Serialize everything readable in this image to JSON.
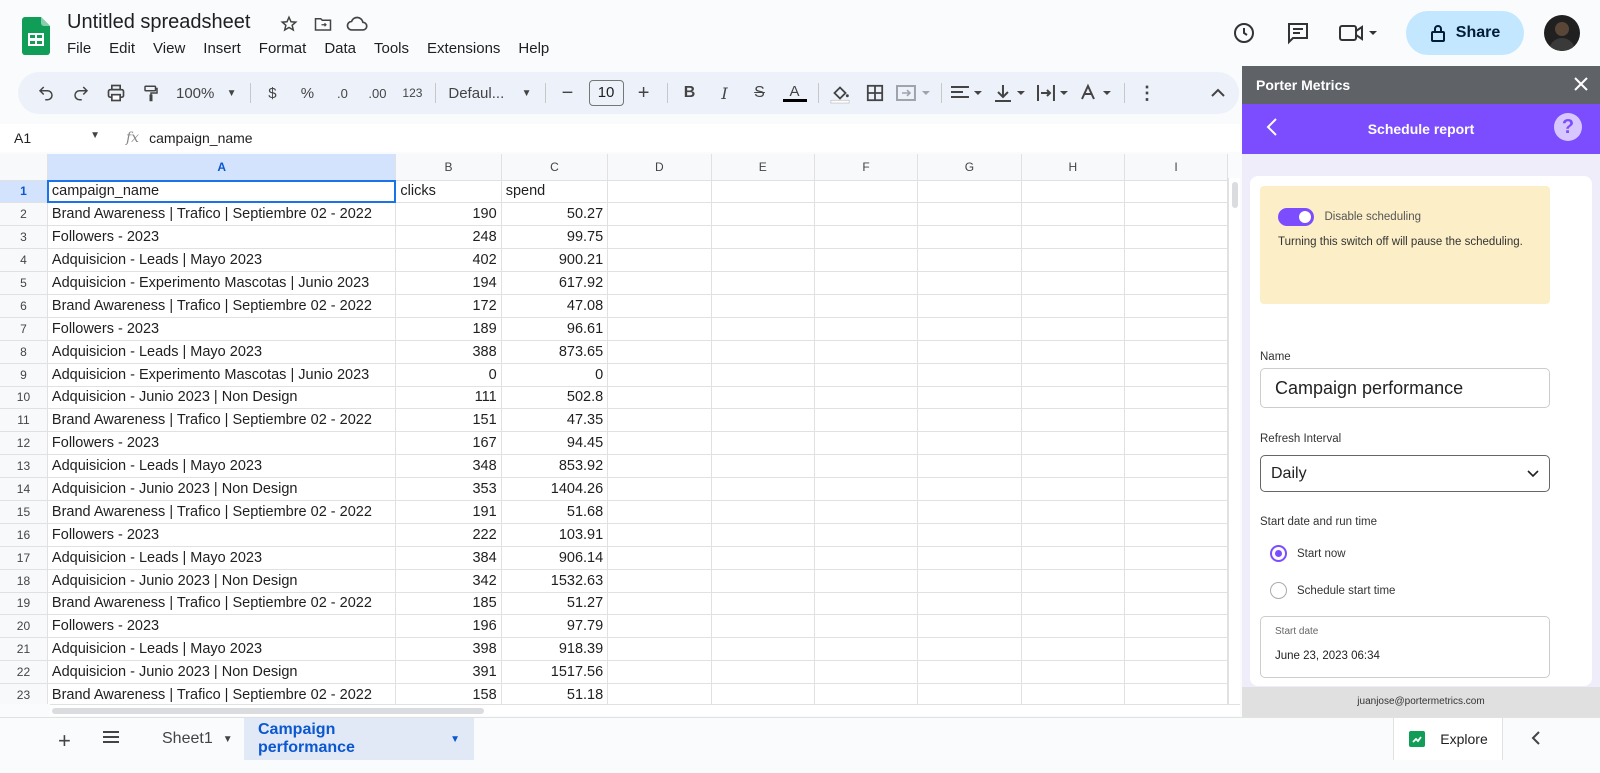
{
  "app": {
    "title": "Untitled spreadsheet"
  },
  "menu": [
    "File",
    "Edit",
    "View",
    "Insert",
    "Format",
    "Data",
    "Tools",
    "Extensions",
    "Help"
  ],
  "share_label": "Share",
  "toolbar": {
    "zoom": "100%",
    "currency": "$",
    "percent": "%",
    "dec_dec": ".0",
    "inc_dec": ".00",
    "format_num": "123",
    "font": "Defaul...",
    "font_size": "10"
  },
  "formula": {
    "cell": "A1",
    "content": "campaign_name"
  },
  "columns": [
    "A",
    "B",
    "C",
    "D",
    "E",
    "F",
    "G",
    "H",
    "I"
  ],
  "rows": [
    [
      "campaign_name",
      "clicks",
      "spend"
    ],
    [
      "Brand Awareness | Trafico | Septiembre 02 - 2022",
      "190",
      "50.27"
    ],
    [
      "Followers - 2023",
      "248",
      "99.75"
    ],
    [
      "Adquisicion - Leads | Mayo 2023",
      "402",
      "900.21"
    ],
    [
      "Adquisicion - Experimento Mascotas | Junio 2023",
      "194",
      "617.92"
    ],
    [
      "Brand Awareness | Trafico | Septiembre 02 - 2022",
      "172",
      "47.08"
    ],
    [
      "Followers - 2023",
      "189",
      "96.61"
    ],
    [
      "Adquisicion - Leads | Mayo 2023",
      "388",
      "873.65"
    ],
    [
      "Adquisicion - Experimento Mascotas | Junio 2023",
      "0",
      "0"
    ],
    [
      "Adquisicion - Junio 2023 | Non Design",
      "111",
      "502.8"
    ],
    [
      "Brand Awareness | Trafico | Septiembre 02 - 2022",
      "151",
      "47.35"
    ],
    [
      "Followers - 2023",
      "167",
      "94.45"
    ],
    [
      "Adquisicion - Leads | Mayo 2023",
      "348",
      "853.92"
    ],
    [
      "Adquisicion - Junio 2023 | Non Design",
      "353",
      "1404.26"
    ],
    [
      "Brand Awareness | Trafico | Septiembre 02 - 2022",
      "191",
      "51.68"
    ],
    [
      "Followers - 2023",
      "222",
      "103.91"
    ],
    [
      "Adquisicion - Leads | Mayo 2023",
      "384",
      "906.14"
    ],
    [
      "Adquisicion - Junio 2023 | Non Design",
      "342",
      "1532.63"
    ],
    [
      "Brand Awareness | Trafico | Septiembre 02 - 2022",
      "185",
      "51.27"
    ],
    [
      "Followers - 2023",
      "196",
      "97.79"
    ],
    [
      "Adquisicion - Leads | Mayo 2023",
      "398",
      "918.39"
    ],
    [
      "Adquisicion - Junio 2023 | Non Design",
      "391",
      "1517.56"
    ],
    [
      "Brand Awareness | Trafico | Septiembre 02 - 2022",
      "158",
      "51.18"
    ]
  ],
  "sheets": {
    "tab1": "Sheet1",
    "tab2": "Campaign performance",
    "explore": "Explore"
  },
  "sidebar": {
    "app_name": "Porter Metrics",
    "title": "Schedule report",
    "help": "?",
    "notice_title": "Disable scheduling",
    "notice_text": "Turning this switch off will pause the scheduling.",
    "name_label": "Name",
    "name_value": "Campaign performance",
    "interval_label": "Refresh Interval",
    "interval_value": "Daily",
    "start_label": "Start date and run time",
    "opt_now": "Start now",
    "opt_schedule": "Schedule start time",
    "date_label": "Start date",
    "date_value": "June 23, 2023 06:34",
    "footer": "juanjose@portermetrics.com"
  },
  "colors": {
    "accent": "#7c4dff",
    "share_bg": "#c2e7ff",
    "selection": "#1a73e8"
  }
}
